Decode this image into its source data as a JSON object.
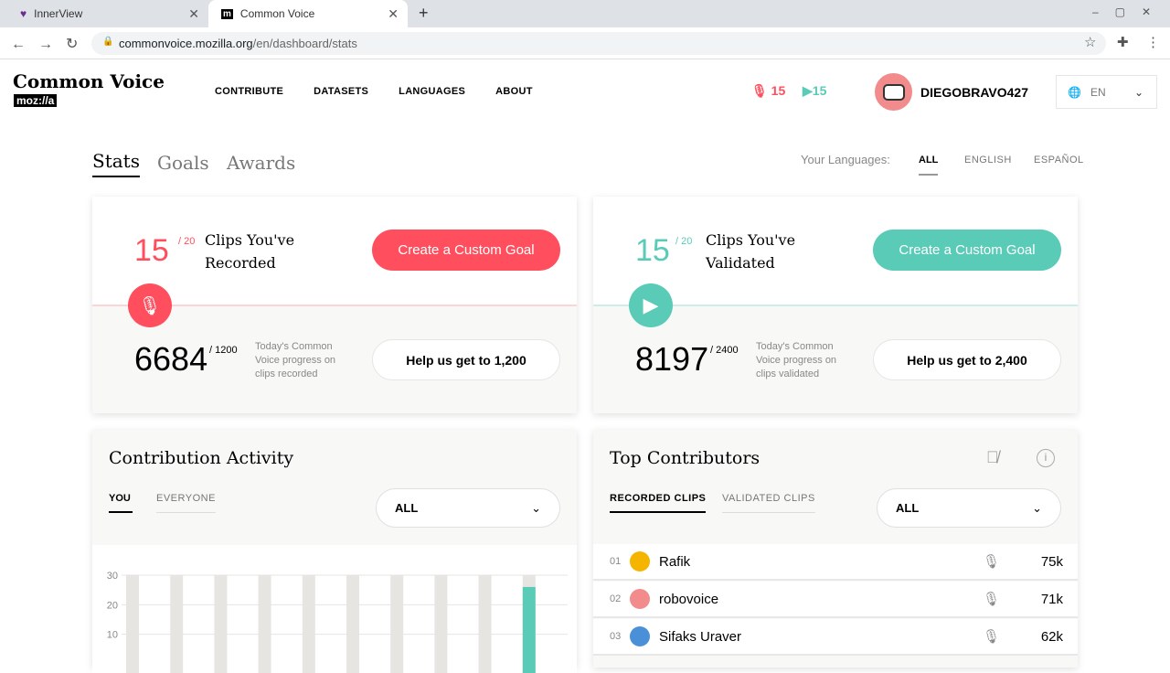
{
  "browser": {
    "tabs": [
      {
        "label": "InnerView"
      },
      {
        "label": "Common Voice"
      }
    ],
    "url_host": "commonvoice.mozilla.org",
    "url_path": "/en/dashboard/stats"
  },
  "header": {
    "logo": "Common Voice",
    "logo_sub": "moz://a",
    "nav": [
      "CONTRIBUTE",
      "DATASETS",
      "LANGUAGES",
      "ABOUT"
    ],
    "recorded_count": "15",
    "validated_count": "15",
    "username": "DIEGOBRAVO427",
    "language": "EN"
  },
  "dashboard": {
    "tabs": [
      "Stats",
      "Goals",
      "Awards"
    ],
    "languages_label": "Your Languages:",
    "languages": [
      "ALL",
      "ENGLISH",
      "ESPAÑOL"
    ]
  },
  "recorded": {
    "count": "15",
    "goal": "/ 20",
    "label1": "Clips You've",
    "label2": "Recorded",
    "button": "Create a Custom Goal",
    "today": "6684",
    "today_goal": "/ 1200",
    "desc": "Today's Common Voice progress on clips recorded",
    "help": "Help us get to 1,200"
  },
  "validated": {
    "count": "15",
    "goal": "/ 20",
    "label1": "Clips You've",
    "label2": "Validated",
    "button": "Create a Custom Goal",
    "today": "8197",
    "today_goal": "/ 2400",
    "desc": "Today's Common Voice progress on clips validated",
    "help": "Help us get to 2,400"
  },
  "activity": {
    "title": "Contribution Activity",
    "tabs": [
      "YOU",
      "EVERYONE"
    ],
    "select": "ALL"
  },
  "contributors": {
    "title": "Top Contributors",
    "tabs": [
      "RECORDED CLIPS",
      "VALIDATED CLIPS"
    ],
    "select": "ALL",
    "rows": [
      {
        "rank": "01",
        "name": "Rafik",
        "count": "75k"
      },
      {
        "rank": "02",
        "name": "robovoice",
        "count": "71k"
      },
      {
        "rank": "03",
        "name": "Sifaks Uraver",
        "count": "62k"
      }
    ]
  },
  "chart_data": {
    "type": "bar",
    "yticks": [
      "30",
      "20",
      "10"
    ],
    "ylim": [
      0,
      30
    ],
    "values": [
      0,
      0,
      0,
      0,
      0,
      0,
      0,
      0,
      0,
      26
    ],
    "colors": {
      "bar": "#59cbb7",
      "track": "#e7e5e2"
    }
  },
  "colors": {
    "red": "#ff4f5e",
    "teal": "#59cbb7"
  }
}
